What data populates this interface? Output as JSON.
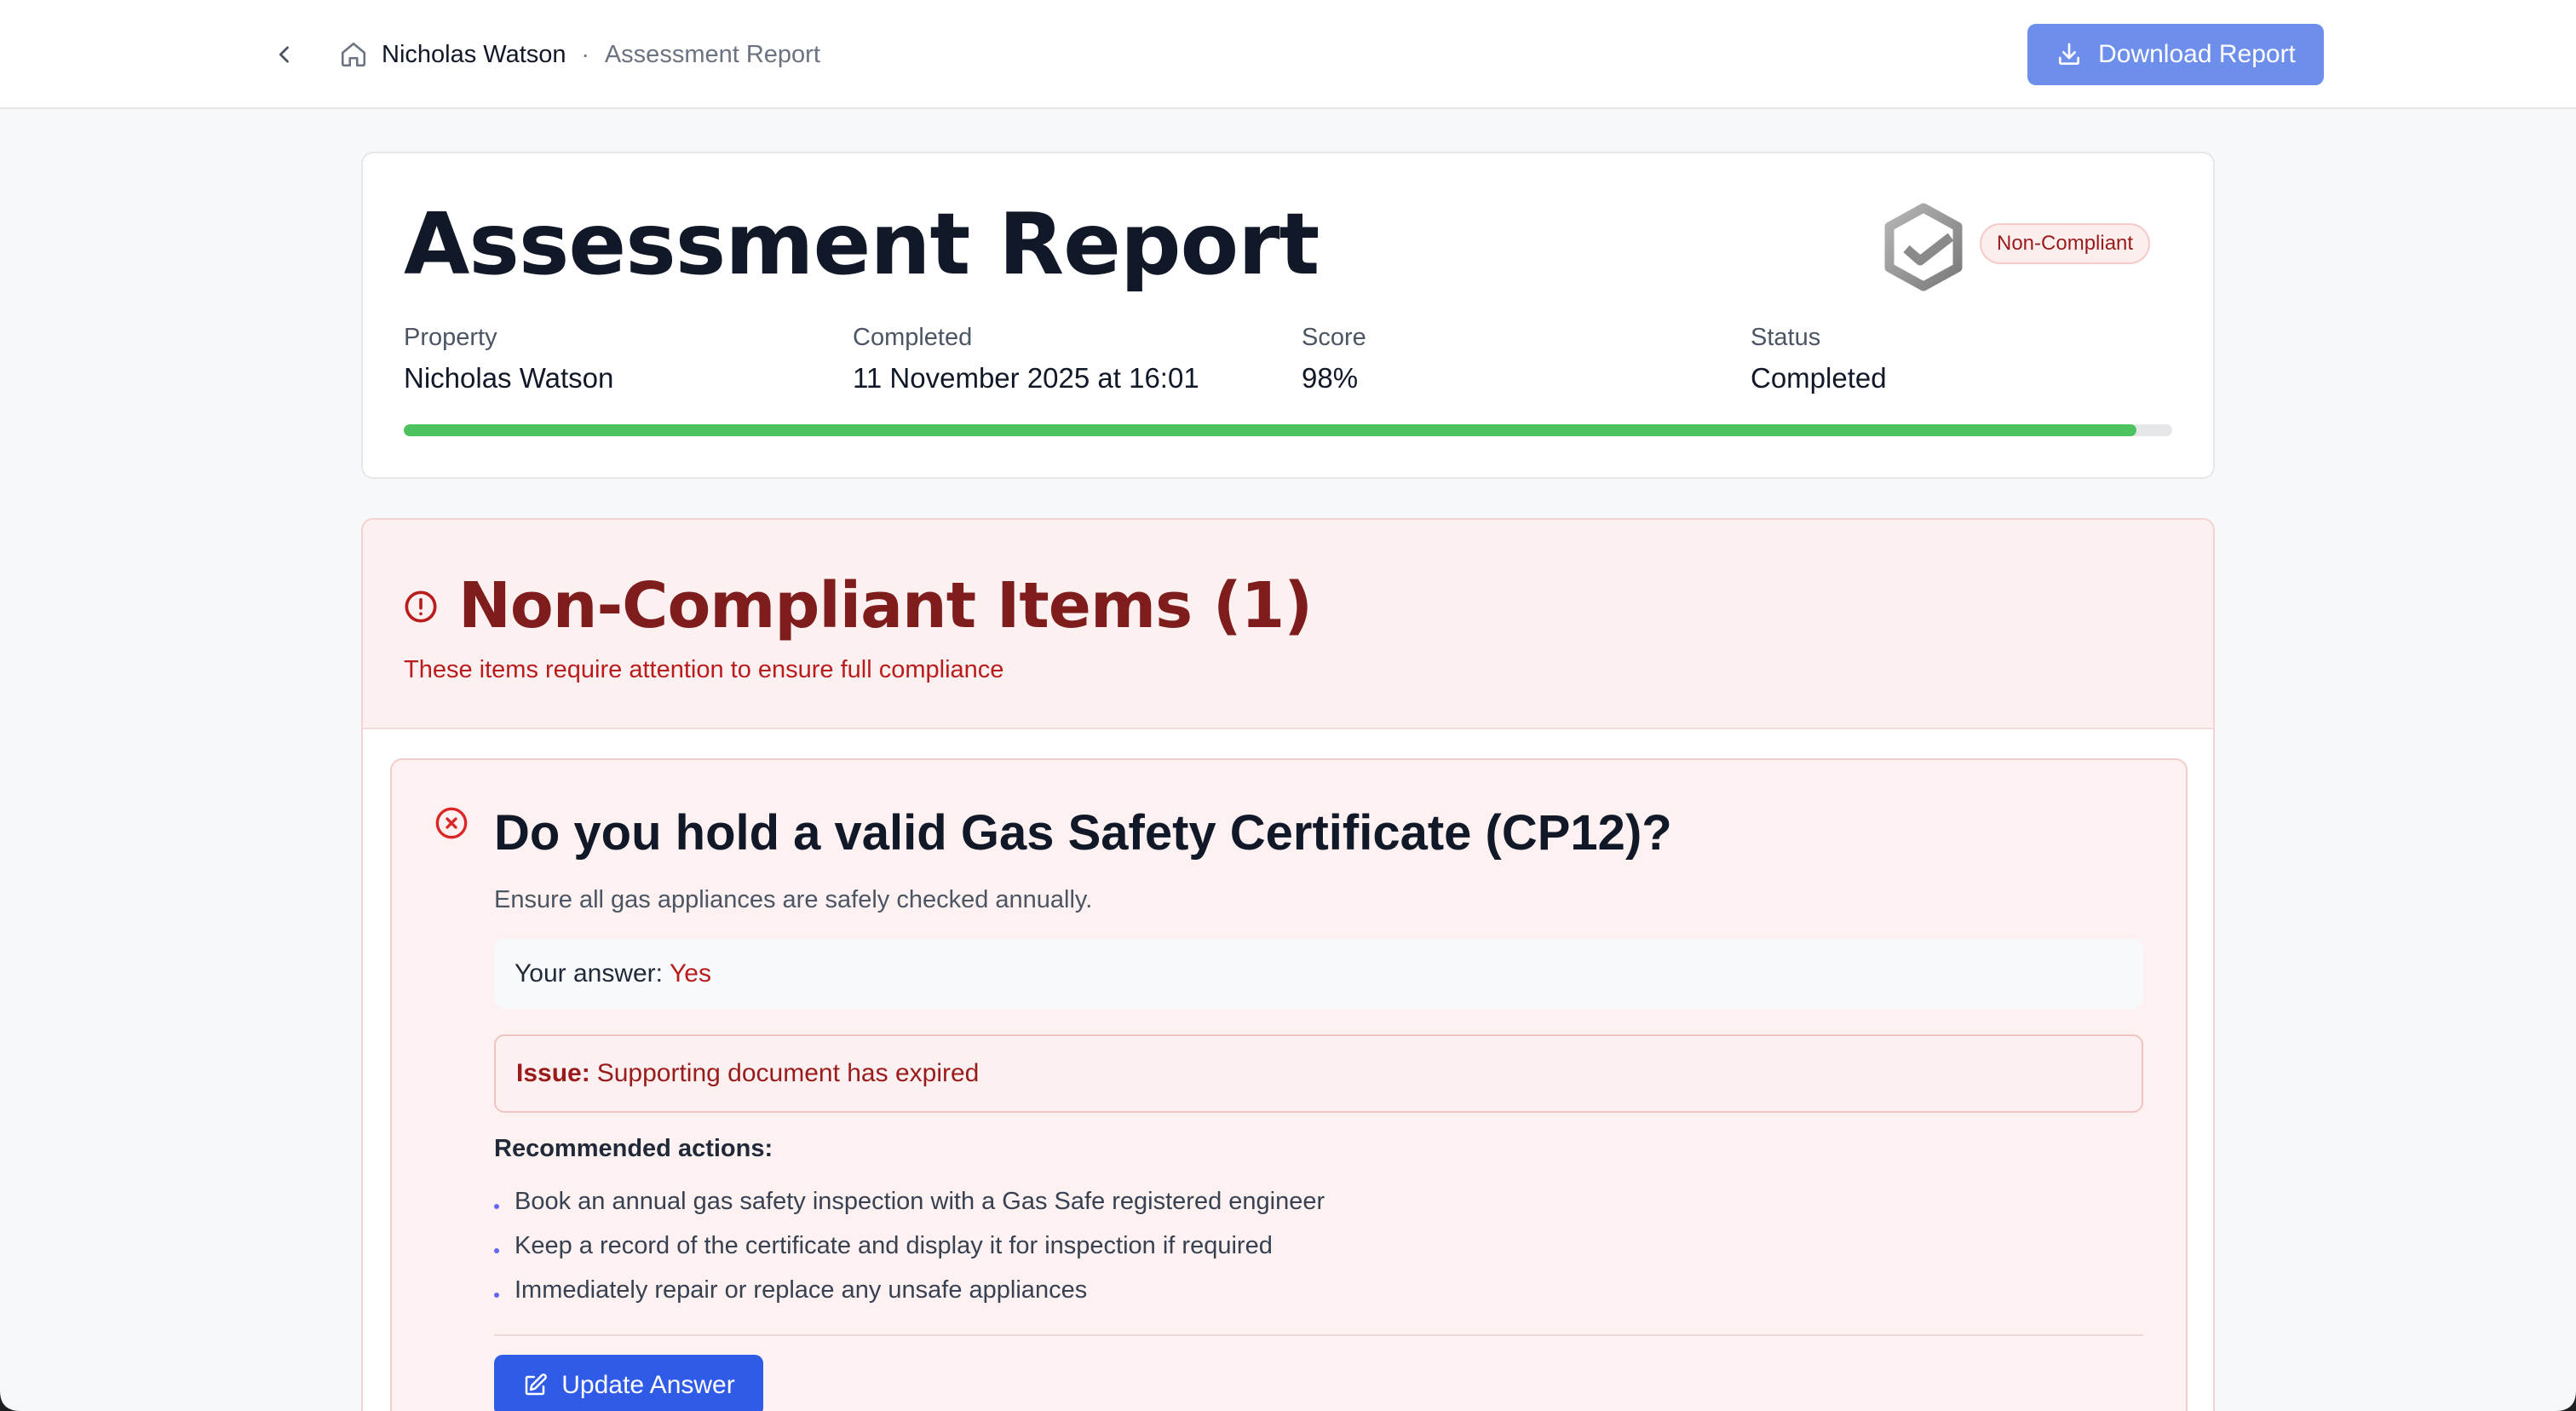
{
  "header": {
    "breadcrumb_name": "Nicholas Watson",
    "breadcrumb_separator": "·",
    "breadcrumb_page": "Assessment Report",
    "download_label": "Download Report"
  },
  "summary": {
    "title": "Assessment Report",
    "status_badge": "Non-Compliant",
    "fields": {
      "property_label": "Property",
      "property_value": "Nicholas Watson",
      "completed_label": "Completed",
      "completed_value": "11 November 2025 at 16:01",
      "score_label": "Score",
      "score_value": "98%",
      "status_label": "Status",
      "status_value": "Completed"
    },
    "progress_fraction": 0.98
  },
  "non_compliant": {
    "heading": "Non-Compliant Items (1)",
    "subheading": "These items require attention to ensure full compliance",
    "items": [
      {
        "question": "Do you hold a valid Gas Safety Certificate (CP12)?",
        "description": "Ensure all gas appliances are safely checked annually.",
        "answer_label": "Your answer:",
        "answer_value": "Yes",
        "issue_label": "Issue:",
        "issue_text": "Supporting document has expired",
        "recommended_title": "Recommended actions:",
        "recommendations": [
          "Book an annual gas safety inspection with a Gas Safe registered engineer",
          "Keep a record of the certificate and display it for inspection if required",
          "Immediately repair or replace any unsafe appliances"
        ],
        "update_label": "Update Answer"
      }
    ]
  },
  "colors": {
    "primary": "#2f5be6",
    "download_button": "#6d8eeb",
    "progress": "#4cc35f",
    "danger": "#b91c1c",
    "danger_dark": "#7f1d1d"
  },
  "icons": {
    "back": "chevron-left-icon",
    "home": "home-icon",
    "download": "download-icon",
    "logo": "hexagon-check-logo",
    "alert": "alert-circle-icon",
    "error": "x-circle-icon",
    "edit": "edit-icon"
  }
}
